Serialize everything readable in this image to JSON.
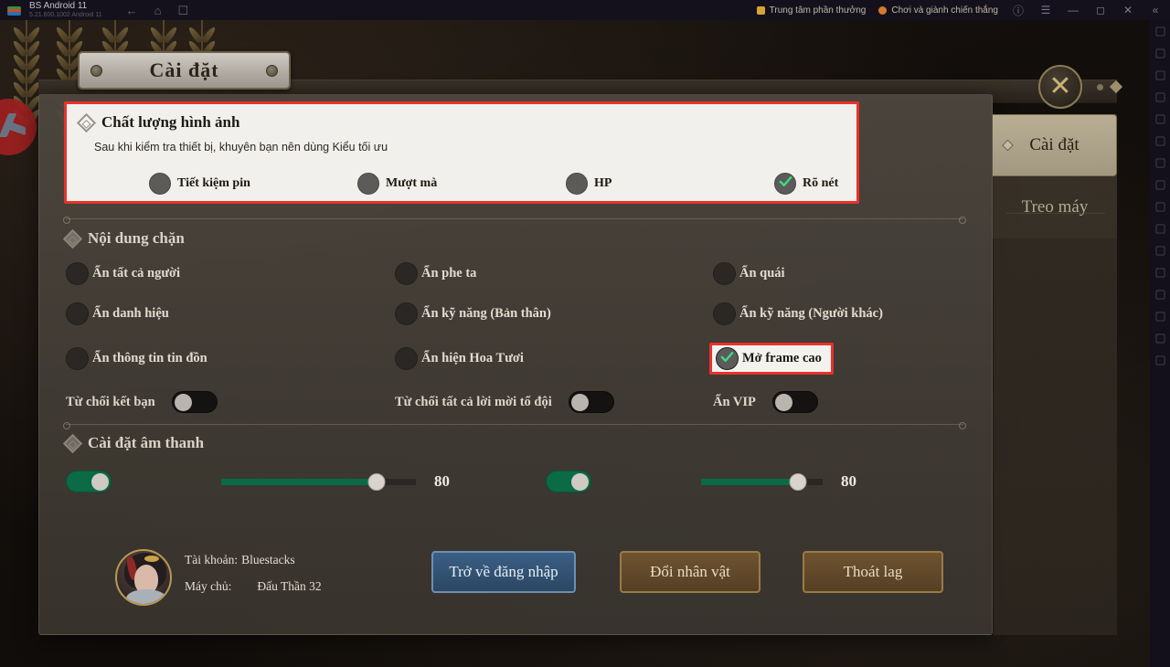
{
  "bluestacks": {
    "title": "BS Android 11",
    "subtitle": "5.21.600.1002 Android 11",
    "nav": [
      {
        "name": "back-icon",
        "glyph": "←"
      },
      {
        "name": "home-icon",
        "glyph": "⌂"
      },
      {
        "name": "recents-icon",
        "glyph": "❐"
      }
    ],
    "promos": [
      {
        "label": "Trung tâm phần thưởng",
        "icon": "crown-icon"
      },
      {
        "label": "Chơi và giành chiến thắng",
        "icon": "trophy-icon"
      }
    ],
    "window_buttons": [
      {
        "name": "help-icon",
        "glyph": "ⓘ"
      },
      {
        "name": "menu-icon",
        "glyph": "☰"
      },
      {
        "name": "minimize-icon",
        "glyph": "—"
      },
      {
        "name": "maximize-icon",
        "glyph": "□"
      },
      {
        "name": "close-icon",
        "glyph": "✕"
      },
      {
        "name": "collapse-sidebar-icon",
        "glyph": "«"
      }
    ],
    "sidebar_icons": [
      "fullscreen-icon",
      "volume-icon",
      "keyboard-mapping-icon",
      "screenshot-icon",
      "record-screen-icon",
      "location-icon",
      "shake-icon",
      "macro-icon",
      "multi-instance-icon",
      "folder-icon",
      "move-icon",
      "rotate-icon",
      "eco-mode-icon",
      "trim-memory-icon",
      "layers-icon",
      "more-icon"
    ]
  },
  "dialog": {
    "title": "Cài đặt",
    "close_label": "✕",
    "tabs": [
      {
        "label": "Cài đặt",
        "active": true
      },
      {
        "label": "Treo máy",
        "active": false
      }
    ]
  },
  "quality": {
    "section_title": "Chất lượng hình ảnh",
    "hint": "Sau khi kiểm tra thiết bị, khuyên bạn nên dùng Kiểu tối ưu",
    "options": [
      {
        "label": "Tiết kiệm pin",
        "selected": false
      },
      {
        "label": "Mượt mà",
        "selected": false
      },
      {
        "label": "HP",
        "selected": false
      },
      {
        "label": "Rõ nét",
        "selected": true
      }
    ]
  },
  "block": {
    "section_title": "Nội dung chặn",
    "checkboxes": [
      {
        "label": "Ẩn tất cả người",
        "checked": false,
        "highlighted": false
      },
      {
        "label": "Ẩn phe ta",
        "checked": false,
        "highlighted": false
      },
      {
        "label": "Ẩn quái",
        "checked": false,
        "highlighted": false
      },
      {
        "label": "Ẩn danh hiệu",
        "checked": false,
        "highlighted": false
      },
      {
        "label": "Ẩn kỹ năng (Bản thân)",
        "checked": false,
        "highlighted": false
      },
      {
        "label": "Ẩn kỹ năng (Người khác)",
        "checked": false,
        "highlighted": false
      },
      {
        "label": "Ẩn thông tin tin đồn",
        "checked": false,
        "highlighted": false
      },
      {
        "label": "Ẩn hiện Hoa Tươi",
        "checked": false,
        "highlighted": false
      },
      {
        "label": "Mở frame cao",
        "checked": true,
        "highlighted": true
      }
    ],
    "toggles": [
      {
        "label": "Từ chối kết bạn",
        "on": false
      },
      {
        "label": "Từ chối tất cả lời mời tổ đội",
        "on": false
      },
      {
        "label": "Ẩn VIP",
        "on": false
      }
    ]
  },
  "sound": {
    "section_title": "Cài đặt âm thanh",
    "controls": [
      {
        "toggle_on": true,
        "value": 80,
        "max": 100,
        "value_label": "80"
      },
      {
        "toggle_on": true,
        "value": 80,
        "max": 100,
        "value_label": "80"
      }
    ]
  },
  "footer": {
    "account_key": "Tài khoản:",
    "account_value": "Bluestacks",
    "server_key": "Máy chủ:",
    "server_value": "Đấu Thần 32",
    "buttons": [
      {
        "label": "Trở về đăng nhập",
        "style": "blue"
      },
      {
        "label": "Đổi nhân vật",
        "style": "gold"
      },
      {
        "label": "Thoát lag",
        "style": "gold"
      }
    ]
  },
  "colors": {
    "highlight_red": "#e8312b",
    "accent_green": "#0b6b46",
    "check_green": "#3ddc84",
    "panel_light": "#f2f0ec",
    "gold": "#9a7b45"
  }
}
